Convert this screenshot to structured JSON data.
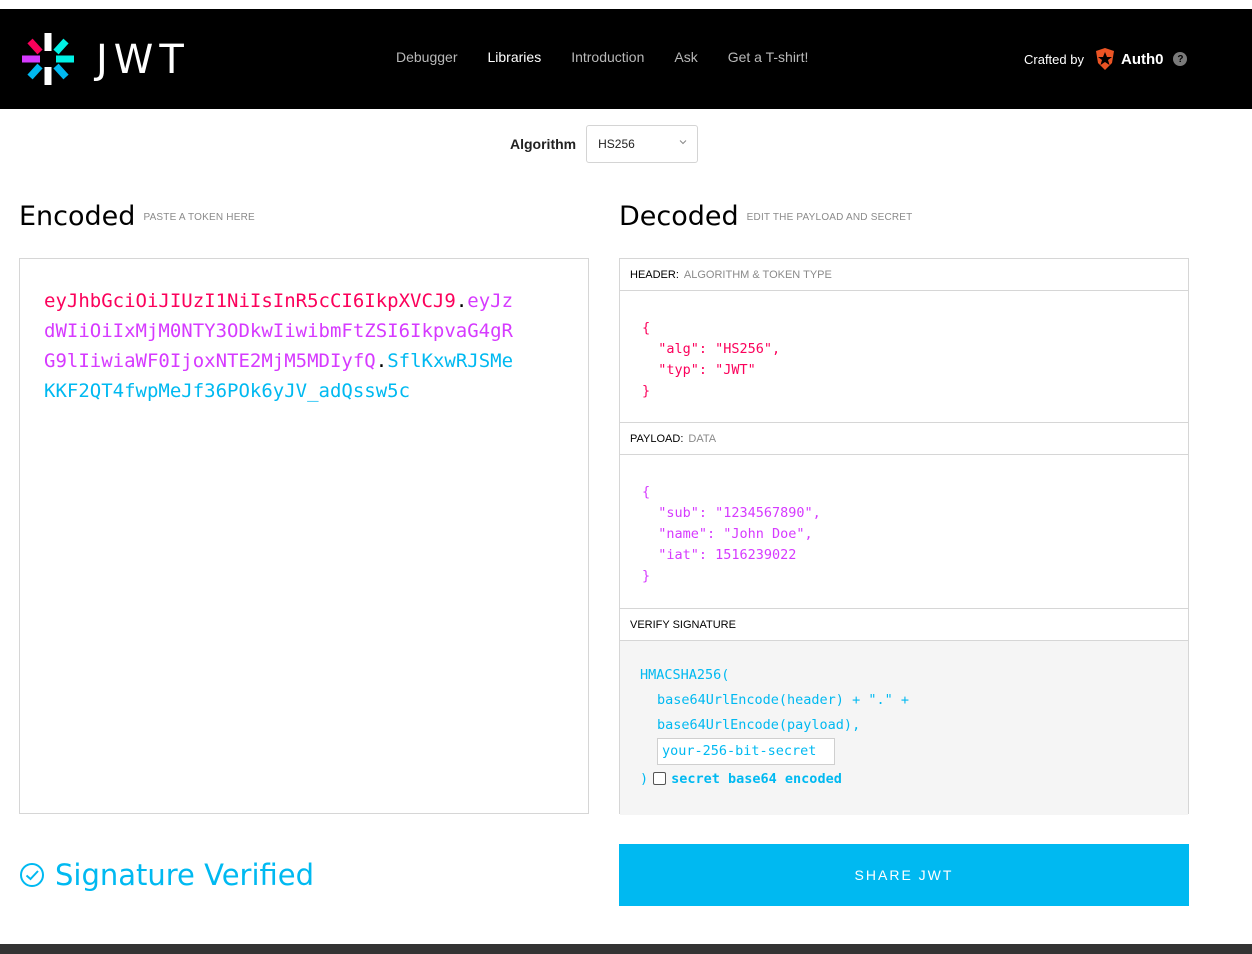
{
  "brand": {
    "logo_text": "JWT",
    "crafted_by": "Crafted by",
    "partner": "Auth0",
    "help": "?"
  },
  "nav": {
    "items": [
      {
        "label": "Debugger",
        "active": false
      },
      {
        "label": "Libraries",
        "active": true
      },
      {
        "label": "Introduction",
        "active": false
      },
      {
        "label": "Ask",
        "active": false
      },
      {
        "label": "Get a T-shirt!",
        "active": false
      }
    ]
  },
  "algorithm": {
    "label": "Algorithm",
    "selected": "HS256"
  },
  "encoded": {
    "title": "Encoded",
    "subtitle": "PASTE A TOKEN HERE",
    "token_header": "eyJhbGciOiJIUzI1NiIsInR5cCI6IkpXVCJ9",
    "token_payload": "eyJzdWIiOiIxMjM0NTY3ODkwIiwibmFtZSI6IkpvaG4gRG9lIiwiaWF0IjoxNTE2MjM5MDIyfQ",
    "token_signature": "SflKxwRJSMeKKF2QT4fwpMeJf36POk6yJV_adQssw5c",
    "dot": "."
  },
  "decoded": {
    "title": "Decoded",
    "subtitle": "EDIT THE PAYLOAD AND SECRET",
    "header_label": "HEADER:",
    "header_sub": "ALGORITHM & TOKEN TYPE",
    "header_json": "{\n  \"alg\": \"HS256\",\n  \"typ\": \"JWT\"\n}",
    "payload_label": "PAYLOAD:",
    "payload_sub": "DATA",
    "payload_json": "{\n  \"sub\": \"1234567890\",\n  \"name\": \"John Doe\",\n  \"iat\": 1516239022\n}",
    "verify_label": "VERIFY SIGNATURE",
    "verify_fn": "HMACSHA256(",
    "verify_line1": "base64UrlEncode(header) + \".\" +",
    "verify_line2": "base64UrlEncode(payload),",
    "secret_placeholder": "your-256-bit-secret",
    "verify_close": ")",
    "base64_label": "secret base64 encoded"
  },
  "status": {
    "verified": "Signature Verified"
  },
  "share": {
    "label": "SHARE JWT"
  },
  "colors": {
    "header": "#fb015b",
    "payload": "#d63aff",
    "signature": "#00b9f1"
  }
}
